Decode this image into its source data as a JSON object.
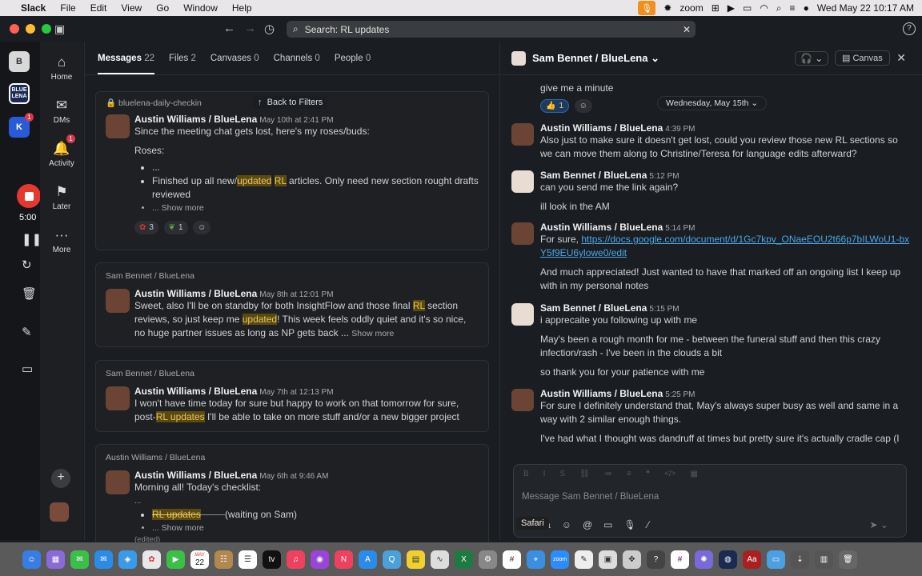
{
  "menubar": {
    "app": "Slack",
    "items": [
      "File",
      "Edit",
      "View",
      "Go",
      "Window",
      "Help"
    ],
    "zoom_label": "zoom",
    "datetime": "Wed May 22  10:17 AM"
  },
  "search": {
    "value": "Search: RL updates"
  },
  "workspaces": {
    "b_label": "B",
    "bluelena_label": "BLUE LENA",
    "badge_2": "1"
  },
  "recorder": {
    "timer": "5:00"
  },
  "nav": {
    "home": "Home",
    "dms": "DMs",
    "activity": "Activity",
    "activity_badge": "1",
    "later": "Later",
    "more": "More"
  },
  "results": {
    "tabs": [
      {
        "label": "Messages",
        "count": "22"
      },
      {
        "label": "Files",
        "count": "2"
      },
      {
        "label": "Canvases",
        "count": "0"
      },
      {
        "label": "Channels",
        "count": "0"
      },
      {
        "label": "People",
        "count": "0"
      }
    ],
    "back": "Back to Filters",
    "r1": {
      "channel": "bluelena-daily-checkin",
      "author": "Austin Williams / BlueLena",
      "time": "May 10th at 2:41 PM",
      "line1": "Since the meeting chat gets lost, here's my roses/buds:",
      "roses": "Roses:",
      "b1": "...",
      "b2_pre": "Finished up all new/",
      "b2_hl1": "updated",
      "b2_sp": " ",
      "b2_hl2": "RL",
      "b2_post": " articles. Only need new section rought drafts reviewed",
      "b3": "... Show more",
      "react1": "3",
      "react2": "1"
    },
    "r2": {
      "channel": "Sam Bennet / BlueLena",
      "author": "Austin Williams / BlueLena",
      "time": "May 8th at 12:01 PM",
      "t1": "Sweet, also I'll be on standby for both InsightFlow and those final ",
      "h1": "RL",
      "t2": " section reviews, so just keep me ",
      "h2": "updated",
      "t3": "! This week feels oddly quiet and it's so nice, no huge partner issues as long as NP gets back ...",
      "more": "Show more"
    },
    "r3": {
      "channel": "Sam Bennet / BlueLena",
      "author": "Austin Williams / BlueLena",
      "time": "May 7th at 12:13 PM",
      "t1": "I won't have time today for sure but happy to work on that tomorrow for sure, post-",
      "h1": "RL updates",
      "t2": " I'll be able to take on more stuff and/or a new bigger project"
    },
    "r4": {
      "channel": "Austin Williams / BlueLena",
      "author": "Austin Williams / BlueLena",
      "time": "May 6th at 9:46 AM",
      "line1": "Morning all! Today's checklist:",
      "dots": "...",
      "b1_hl": "RL updates",
      "b1_post": "(waiting on Sam)",
      "b2": "... Show more",
      "edited": "(edited)"
    }
  },
  "conversation": {
    "title": "Sam Bennet / BlueLena",
    "canvas": "Canvas",
    "date_pill": "Wednesday, May 15th",
    "m0": {
      "text": "give me a minute",
      "react": "1"
    },
    "m1": {
      "author": "Austin Williams / BlueLena",
      "time": "4:39 PM",
      "text": "Also just to make sure it doesn't get lost, could you review those new RL sections so we can move them along to Christine/Teresa for language edits afterward?"
    },
    "m2": {
      "author": "Sam Bennet / BlueLena",
      "time": "5:12 PM",
      "text1": "can you send me the link again?",
      "text2": "ill look in the AM"
    },
    "m3": {
      "author": "Austin Williams / BlueLena",
      "time": "5:14 PM",
      "pre": "For sure, ",
      "link": "https://docs.google.com/document/d/1Gc7kpv_ONaeEOU2t66p7bILWoU1-bxY5f9EU6ylowe0/edit",
      "text2": "And much appreciated! Just wanted to have that marked off an ongoing list I keep up with in my personal notes"
    },
    "m4": {
      "author": "Sam Bennet / BlueLena",
      "time": "5:15 PM",
      "text1": "i apprecaite you following up with me",
      "text2": "May's been a rough month for me - between the funeral stuff and then this crazy infection/rash - I've been in the clouds a bit",
      "text3": "so thank you for your patience with me"
    },
    "m5": {
      "author": "Austin Williams / BlueLena",
      "time": "5:25 PM",
      "text1": "For sure I definitely understand that, May's always super busy as well and same in a way with 2 similar enough things.",
      "text2": "I've had what I thought was dandruff at times but pretty sure it's actually cradle cap (I"
    },
    "composer_placeholder": "Message Sam Bennet / BlueLena"
  },
  "tooltip": "Safari",
  "dock": {
    "calendar_month": "MAY",
    "calendar_day": "22",
    "tv_label": "tv",
    "zoom_label": "zoom"
  }
}
